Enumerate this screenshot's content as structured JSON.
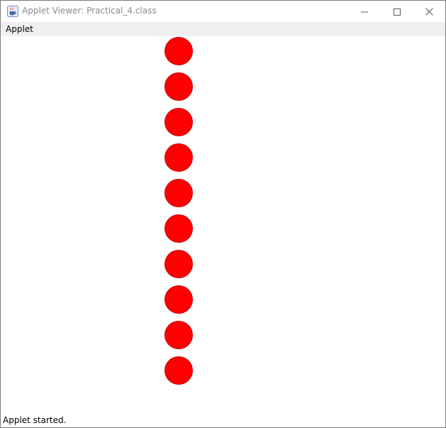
{
  "window": {
    "title": "Applet Viewer: Practical_4.class",
    "icon": "java-cup-icon",
    "controls": {
      "minimize_icon": "minimize-icon",
      "maximize_icon": "maximize-icon",
      "close_icon": "close-icon"
    }
  },
  "menubar": {
    "items": [
      {
        "label": "Applet"
      }
    ]
  },
  "applet": {
    "shape": "circle",
    "fill_color": "#ff0000",
    "outline_color": "#c80000",
    "circle_count": 10
  },
  "status": {
    "text": "Applet started."
  }
}
